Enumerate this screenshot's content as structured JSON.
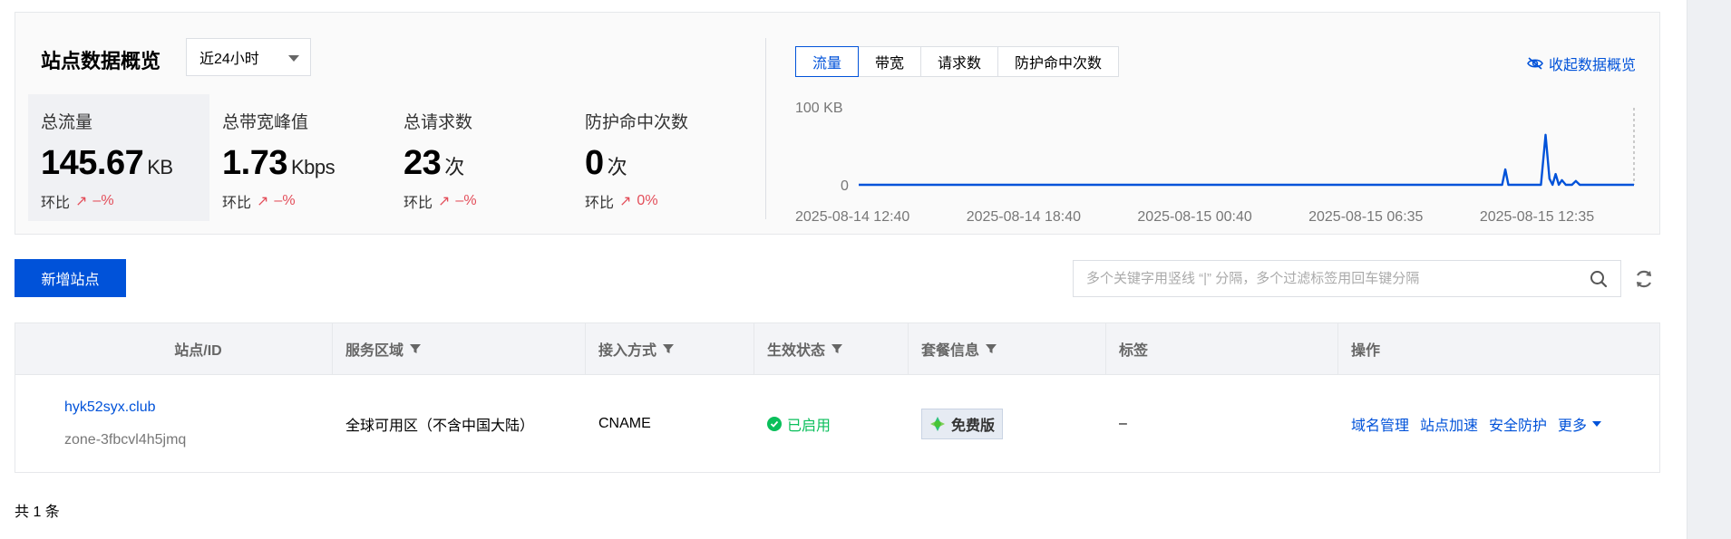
{
  "overview": {
    "title": "站点数据概览",
    "range_selected": "近24小时",
    "metrics": [
      {
        "label": "总流量",
        "value": "145.67",
        "unit": "KB",
        "trend_label": "环比",
        "trend_value": "–%"
      },
      {
        "label": "总带宽峰值",
        "value": "1.73",
        "unit": "Kbps",
        "trend_label": "环比",
        "trend_value": "–%"
      },
      {
        "label": "总请求数",
        "value": "23",
        "unit": "次",
        "trend_label": "环比",
        "trend_value": "–%"
      },
      {
        "label": "防护命中次数",
        "value": "0",
        "unit": "次",
        "trend_label": "环比",
        "trend_value": "0%"
      }
    ],
    "tabs": [
      "流量",
      "带宽",
      "请求数",
      "防护命中次数"
    ],
    "active_tab": "流量",
    "collapse_label": "收起数据概览"
  },
  "chart_data": {
    "type": "line",
    "title": "",
    "xlabel": "",
    "ylabel": "",
    "y_ticks": [
      "100 KB",
      "0"
    ],
    "x_ticks": [
      "2025-08-14 12:40",
      "2025-08-14 18:40",
      "2025-08-15 00:40",
      "2025-08-15 06:35",
      "2025-08-15 12:35"
    ],
    "series": [
      {
        "color": "#0052d9",
        "points": [
          [
            0,
            0
          ],
          [
            0.83,
            0
          ],
          [
            0.834,
            20
          ],
          [
            0.838,
            0
          ],
          [
            0.88,
            0
          ],
          [
            0.886,
            65
          ],
          [
            0.891,
            8
          ],
          [
            0.895,
            0
          ],
          [
            0.899,
            14
          ],
          [
            0.903,
            0
          ],
          [
            0.907,
            6
          ],
          [
            0.912,
            0
          ],
          [
            0.92,
            0
          ],
          [
            0.925,
            5
          ],
          [
            0.93,
            0
          ],
          [
            1,
            0
          ]
        ]
      }
    ],
    "ylim": [
      0,
      100
    ],
    "grid": false
  },
  "toolbar": {
    "add_site_label": "新增站点",
    "search_placeholder": "多个关键字用竖线 “|” 分隔，多个过滤标签用回车键分隔"
  },
  "table": {
    "headers": [
      "站点/ID",
      "服务区域",
      "接入方式",
      "生效状态",
      "套餐信息",
      "标签",
      "操作"
    ],
    "rows": [
      {
        "site": "hyk52syx.club",
        "zone_id": "zone-3fbcvl4h5jmq",
        "area": "全球可用区（不含中国大陆）",
        "access": "CNAME",
        "status": "已启用",
        "plan": "免费版",
        "tag": "–",
        "ops": [
          "域名管理",
          "站点加速",
          "安全防护"
        ],
        "more": "更多"
      }
    ]
  },
  "footer": {
    "total": "共 1 条"
  },
  "colors": {
    "accent": "#0052d9",
    "success": "#0abf5b",
    "danger": "#e34d59"
  }
}
